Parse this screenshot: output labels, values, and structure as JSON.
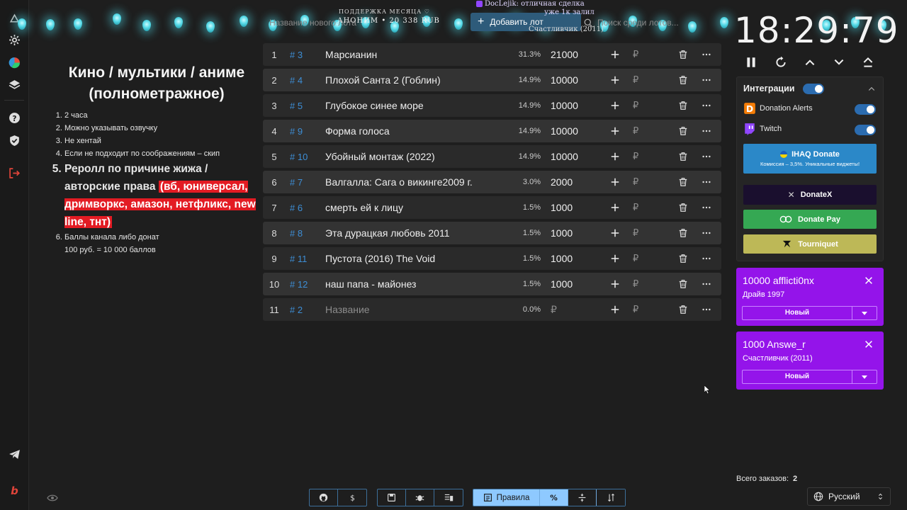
{
  "overlay": {
    "donate_label": "ПОДДЕРЖКА МЕСЯЦА ♡",
    "donate_line": "АНОНИМ • 20 338 RUB",
    "chat_line1_user": "DocLejik",
    "chat_line1_text": "отличная сделка",
    "chat_line2_text": "уже 1к залил",
    "lucky_text": "Счастливчик (2011)"
  },
  "toolbar_top": {
    "name_placeholder": "Название нового лота",
    "add_button": "Добавить лот",
    "search_placeholder": "Поиск среди лотов..."
  },
  "timer": "18:29:79",
  "rules": {
    "title": "Кино / мультики / аниме (полнометражное)",
    "items": [
      {
        "text": "2 часа"
      },
      {
        "text": "Можно указывать озвучку"
      },
      {
        "text": "Не хентай"
      },
      {
        "text": "Если не подходит по соображениям – скип"
      },
      {
        "text": "Реролл по причине жижа / авторские права",
        "highlight": "(вб, юниверсал, дримворкс, амазон, нетфликс, new line, тнт)"
      },
      {
        "text": "Баллы канала либо донат",
        "note": "100 руб. = 10 000 баллов"
      }
    ]
  },
  "lots": [
    {
      "index": "1",
      "id": "# 3",
      "name": "Марсианин",
      "percent": "31.3%",
      "amount": "21000"
    },
    {
      "index": "2",
      "id": "# 4",
      "name": "Плохой Санта 2 (Гоблин)",
      "percent": "14.9%",
      "amount": "10000"
    },
    {
      "index": "3",
      "id": "# 5",
      "name": "Глубокое синее море",
      "percent": "14.9%",
      "amount": "10000"
    },
    {
      "index": "4",
      "id": "# 9",
      "name": "Форма голоса",
      "percent": "14.9%",
      "amount": "10000"
    },
    {
      "index": "5",
      "id": "# 10",
      "name": "Убойный монтаж (2022)",
      "percent": "14.9%",
      "amount": "10000"
    },
    {
      "index": "6",
      "id": "# 7",
      "name": "Валгалла: Сага о викинге2009 г.",
      "percent": "3.0%",
      "amount": "2000"
    },
    {
      "index": "7",
      "id": "# 6",
      "name": "смерть ей к лицу",
      "percent": "1.5%",
      "amount": "1000"
    },
    {
      "index": "8",
      "id": "# 8",
      "name": "Эта дурацкая любовь 2011",
      "percent": "1.5%",
      "amount": "1000"
    },
    {
      "index": "9",
      "id": "# 11",
      "name": "Пустота (2016) The Void",
      "percent": "1.5%",
      "amount": "1000"
    },
    {
      "index": "10",
      "id": "# 12",
      "name": "наш папа - майонез",
      "percent": "1.5%",
      "amount": "1000"
    },
    {
      "index": "11",
      "id": "# 2",
      "name": "Название",
      "percent": "0.0%",
      "amount": "₽",
      "placeholder": true
    }
  ],
  "currency_symbol": "₽",
  "integrations": {
    "title": "Интеграции",
    "items": [
      {
        "name": "Donation Alerts"
      },
      {
        "name": "Twitch"
      }
    ],
    "services": [
      {
        "name": "IHAQ Donate",
        "sub": "Комиссия – 3,5%. Уникальные виджеты!",
        "color": "#2b88c8"
      },
      {
        "name": "DonateX",
        "color": "#1a0f2e"
      },
      {
        "name": "Donate Pay",
        "color": "#35a853"
      },
      {
        "name": "Tourniquet",
        "color": "#bdb857"
      }
    ]
  },
  "orders": [
    {
      "amount_user": "10000 afflicti0nx",
      "title": "Драйв 1997",
      "status": "Новый"
    },
    {
      "amount_user": "1000 Answe_r",
      "title": "Счастливчик (2011)",
      "status": "Новый"
    }
  ],
  "totals": {
    "label": "Всего заказов:",
    "value": "2"
  },
  "language": "Русский",
  "bottom_toolbar": {
    "rules_label": "Правила"
  },
  "colors": {
    "accent_blue": "#3d8ed6",
    "order_purple": "#9414ea",
    "highlight_red": "#e31b23"
  }
}
